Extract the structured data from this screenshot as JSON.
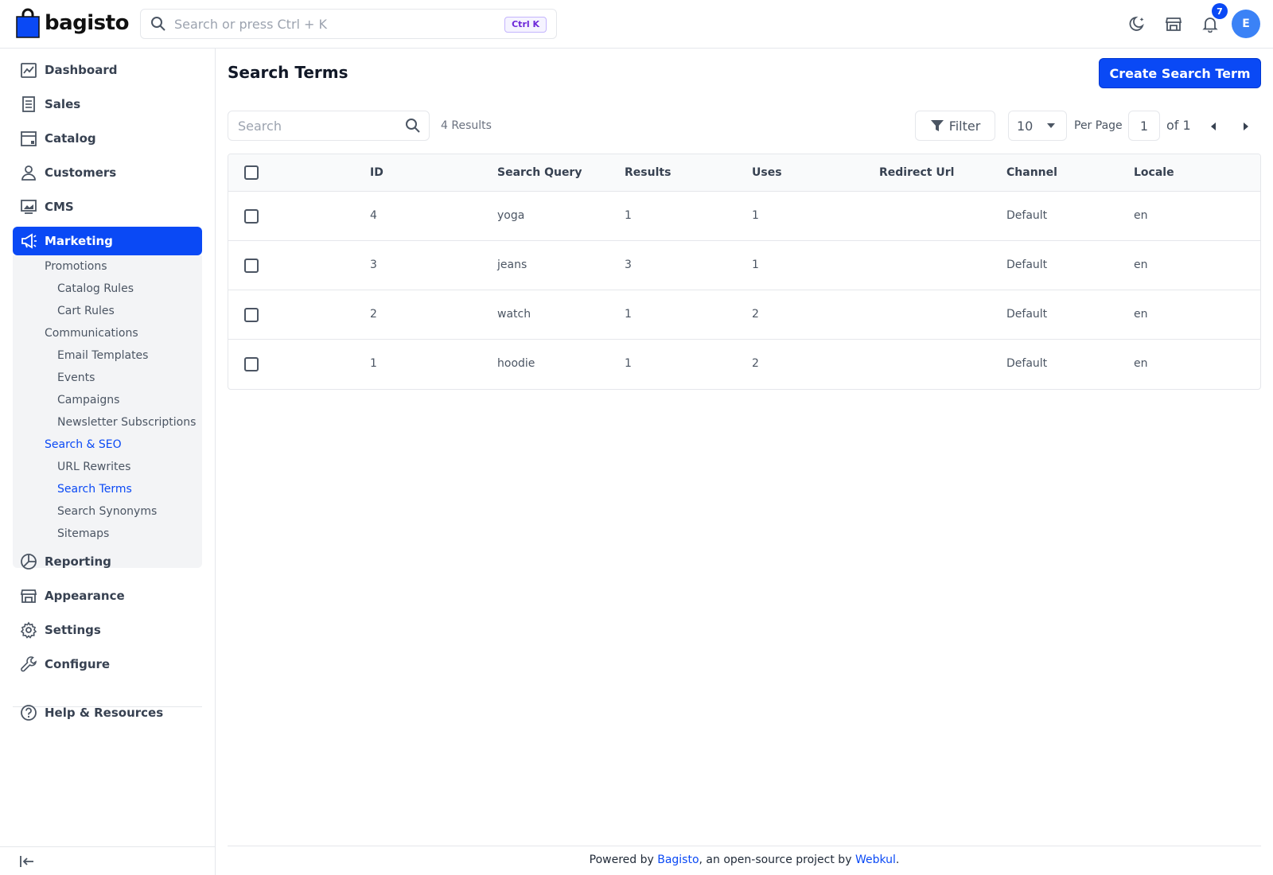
{
  "brand": {
    "name": "bagisto"
  },
  "header": {
    "search_placeholder": "Search or press Ctrl + K",
    "shortcut": "Ctrl K",
    "notification_count": "7",
    "avatar_initial": "E"
  },
  "sidebar": {
    "items": [
      {
        "label": "Dashboard",
        "icon": "dashboard-icon"
      },
      {
        "label": "Sales",
        "icon": "receipt-icon"
      },
      {
        "label": "Catalog",
        "icon": "catalog-icon"
      },
      {
        "label": "Customers",
        "icon": "user-icon"
      },
      {
        "label": "CMS",
        "icon": "monitor-icon"
      },
      {
        "label": "Marketing",
        "icon": "megaphone-icon",
        "active": true
      },
      {
        "label": "Reporting",
        "icon": "pie-chart-icon"
      },
      {
        "label": "Appearance",
        "icon": "store-icon"
      },
      {
        "label": "Settings",
        "icon": "gear-icon"
      },
      {
        "label": "Configure",
        "icon": "wrench-icon"
      },
      {
        "label": "Help & Resources",
        "icon": "help-icon"
      }
    ],
    "marketing_submenu": [
      {
        "label": "Promotions",
        "level": 1
      },
      {
        "label": "Catalog Rules",
        "level": 2
      },
      {
        "label": "Cart Rules",
        "level": 2
      },
      {
        "label": "Communications",
        "level": 1
      },
      {
        "label": "Email Templates",
        "level": 2
      },
      {
        "label": "Events",
        "level": 2
      },
      {
        "label": "Campaigns",
        "level": 2
      },
      {
        "label": "Newsletter Subscriptions",
        "level": 2
      },
      {
        "label": "Search & SEO",
        "level": 1,
        "active": true
      },
      {
        "label": "URL Rewrites",
        "level": 2
      },
      {
        "label": "Search Terms",
        "level": 2,
        "active": true
      },
      {
        "label": "Search Synonyms",
        "level": 2
      },
      {
        "label": "Sitemaps",
        "level": 2
      }
    ]
  },
  "page": {
    "title": "Search Terms",
    "create_button": "Create Search Term"
  },
  "toolbar": {
    "search_placeholder": "Search",
    "results_text": "4 Results",
    "filter_label": "Filter",
    "per_page_value": "10",
    "per_page_label": "Per Page",
    "current_page": "1",
    "page_total": "of 1"
  },
  "table": {
    "columns": [
      "ID",
      "Search Query",
      "Results",
      "Uses",
      "Redirect Url",
      "Channel",
      "Locale"
    ],
    "rows": [
      {
        "id": "4",
        "query": "yoga",
        "results": "1",
        "uses": "1",
        "redirect_url": "",
        "channel": "Default",
        "locale": "en"
      },
      {
        "id": "3",
        "query": "jeans",
        "results": "3",
        "uses": "1",
        "redirect_url": "",
        "channel": "Default",
        "locale": "en"
      },
      {
        "id": "2",
        "query": "watch",
        "results": "1",
        "uses": "2",
        "redirect_url": "",
        "channel": "Default",
        "locale": "en"
      },
      {
        "id": "1",
        "query": "hoodie",
        "results": "1",
        "uses": "2",
        "redirect_url": "",
        "channel": "Default",
        "locale": "en"
      }
    ]
  },
  "footer": {
    "prefix": "Powered by ",
    "link1": "Bagisto",
    "middle": ", an open-source project by ",
    "link2": "Webkul",
    "suffix": "."
  },
  "colors": {
    "accent": "#0a49f5",
    "border": "#e5e7eb",
    "submenu_bg": "#f3f4f6"
  }
}
